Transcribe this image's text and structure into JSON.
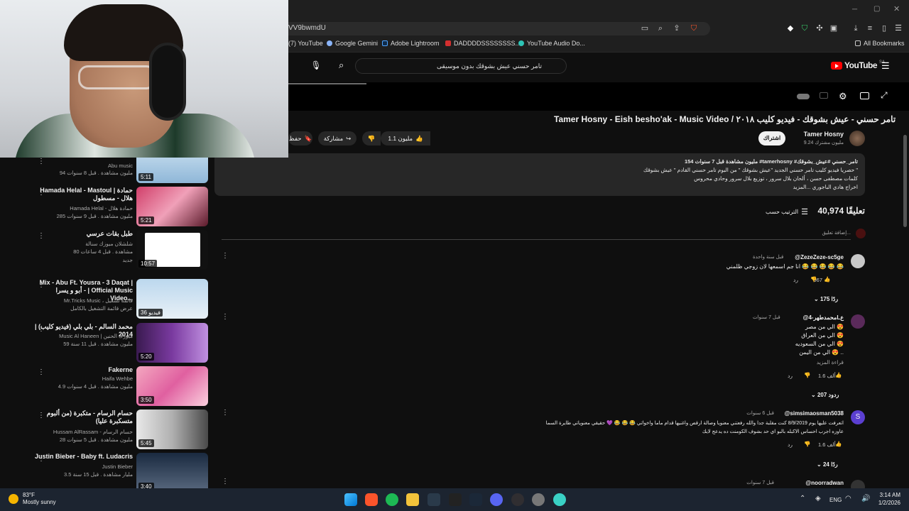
{
  "browser": {
    "url": "VV9bwmdU",
    "bookmarks": [
      "(7) YouTube",
      "Google Gemini",
      "Adobe Lightroom",
      "DADDDDSSSSSSSS...",
      "YouTube Audio Do..."
    ],
    "all_bookmarks": "All Bookmarks"
  },
  "youtube": {
    "logo": "YouTube",
    "region": "SA",
    "search_value": "تامر حسني عيش بشوقك بدون موسيقى"
  },
  "video": {
    "title": "Tamer Hosny - Eish besho'ak - Music Video / تامر حسني - عيش بشوقك - فيديو كليب ٢٠١٨",
    "channel": "Tamer Hosny",
    "subscribers": "9.24 مليون مشترك",
    "subscribe_label": "اشتراك",
    "likes": "1.1 مليون",
    "share_label": "مشاركة",
    "save_label": "حفظ"
  },
  "description": {
    "stats": "154 مليون مشاهدة  قبل 7 سنوات  #tamerhosny #تامر_حسني #عيش_بشوقك",
    "line1": "حصريا فيديو كليب تامر حسني الجديد \"عيش بشوقك \" من البوم تامر حسني القادم \" عيش بشوقك \"",
    "line2": "كلمات مصطفى حسن ، ألحان بلال سرور ، توزيع بلال سرور وحادي محروس",
    "line3": "اخراج هادي الباجوري  ...المزيد"
  },
  "comments_header": {
    "count": "40,974 تعليقًا",
    "sort_label": "الترتيب حسب",
    "add_placeholder": "إضافة تعليق..."
  },
  "comments": [
    {
      "author": "@ZezeZeze-sc5ge",
      "time": "قبل سنة واحدة",
      "text": [
        "انا جم اسمعها لان زوجي ظلمني 😂 😂 😂 😂 😂"
      ],
      "likes": "967",
      "reply": "رد",
      "replies": "175 ردًا"
    },
    {
      "author": "@محمدطهر-4Lع",
      "time": "قبل 7 سنوات",
      "text": [
        "الي من مصر 😍",
        "الي من العراق 😍",
        "الي من السعوديه 😍",
        "الي من اليمن 😍 .."
      ],
      "more": "قراءة المزيد",
      "likes": "1.6 ألف",
      "reply": "رد",
      "replies": "207 ردود"
    },
    {
      "author": "@simsimaosman5038",
      "time": "قبل 6 سنوات",
      "text": [
        "اتعرفت عليها يوم 8/9/2019 كنت مقلبة جدا والله رفعتني معنويا وصالة ارقص واغنيها قدام ماما واخواتي 😂 😂 😂 💜 حقيقي معنوياتي طايرة السما",
        "عاوزه اجرب احساس الاكبله بالبو اي حد بشوف الكومنت ده يدعج لايك"
      ],
      "likes": "1.6 ألف",
      "reply": "رد",
      "replies": "24 ردًا"
    },
    {
      "author": "@noorradwan",
      "time": "قبل 7 سنوات"
    }
  ],
  "sidebar": [
    {
      "title": "",
      "channel": "Abu music",
      "meta": "94 مليون مشاهدة . قبل 8 سنوات",
      "duration": "5:11"
    },
    {
      "title": "Hamada Helal - Mastoul | حمادة هلال - مسطول",
      "channel": "Hamada Helal - حمادة هلال",
      "meta": "285 مليون مشاهدة . قبل 9 سنوات",
      "duration": "5:21"
    },
    {
      "title": "طبل بقات عرسي",
      "channel": "شلشلان ميوزك سنالة",
      "meta": "80 مشاهدة . قبل 4 ساعات",
      "badge": "جديد",
      "duration": "10:57"
    },
    {
      "title": "Mix - Abu Ft. Yousra - 3 Daqat | أبو و يسرا - | Official Music Video...",
      "channel": "Mr.Tricks Music ، قائمة تشغيل",
      "meta": "عرض قائمة التشغيل بالكامل",
      "duration": "36 فيديو"
    },
    {
      "title": "محمد السالم - بلي بلي (فيديو كليب) | 2014",
      "channel": "Music Al Haneen | ميوزك الحنين",
      "meta": "59 مليون مشاهدة . قبل 11 سنة",
      "duration": "5:20"
    },
    {
      "title": "Fakerne",
      "channel": "Haifa Wehbe",
      "meta": "4.9 مليون مشاهدة . قبل 4 سنوات",
      "duration": "3:50"
    },
    {
      "title": "حسام الرسام - متكبرة (من ألبوم متسكبرة عليا)",
      "channel": "Hussam AlRassam - حسام الرسام",
      "meta": "28 مليون مشاهدة . قبل 5 سنوات",
      "duration": "5:45"
    },
    {
      "title": "Justin Bieber - Baby ft. Ludacris",
      "channel": "Justin Bieber",
      "meta": "3.5 مليار مشاهدة . قبل 15 سنة",
      "duration": "3:40"
    }
  ],
  "taskbar": {
    "weather_temp": "83°F",
    "weather_desc": "Mostly sunny",
    "lang": "ENG",
    "time": "3:14 AM",
    "date": "1/2/2026"
  },
  "colors": {
    "bg": "#0f0f0f",
    "card": "#272727",
    "brand_red": "#ff0000",
    "taskbar": "#1c2430"
  }
}
